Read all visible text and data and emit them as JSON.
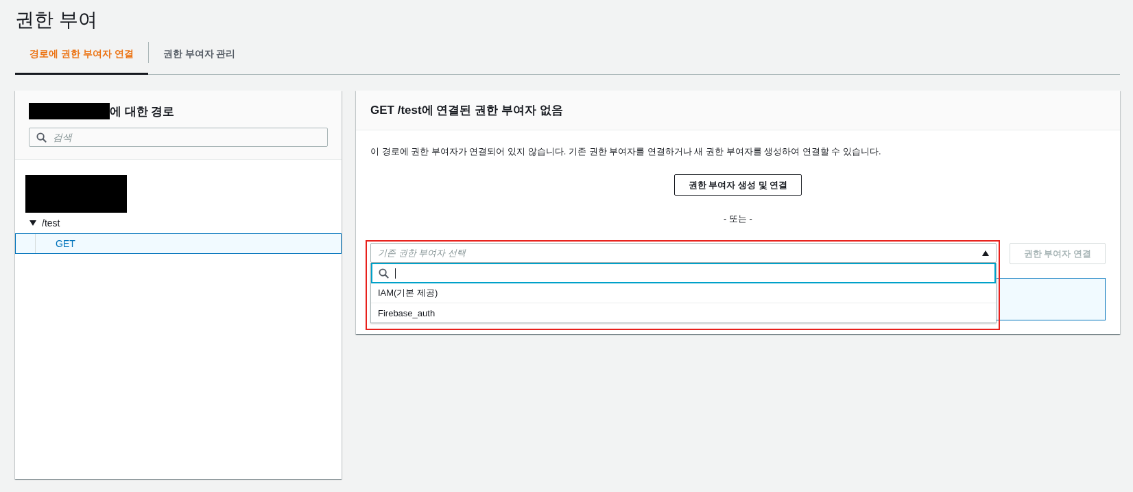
{
  "page": {
    "title": "권한 부여"
  },
  "tabs": [
    {
      "label": "경로에 권한 부여자 연결",
      "selected": true
    },
    {
      "label": "권한 부여자 관리",
      "selected": false
    }
  ],
  "routes_panel": {
    "title_suffix": "에 대한 경로",
    "search": {
      "placeholder": "검색"
    },
    "tree": [
      {
        "label": "/test",
        "expanded": true,
        "children": [
          {
            "label": "GET",
            "selected": true
          }
        ]
      }
    ]
  },
  "detail_panel": {
    "title": "GET /test에 연결된 권한 부여자 없음",
    "description": "이 경로에 권한 부여자가 연결되어 있지 않습니다. 기존 권한 부여자를 연결하거나 새 권한 부여자를 생성하여 연결할 수 있습니다.",
    "create_button": "권한 부여자 생성 및 연결",
    "separator": "- 또는 -",
    "select": {
      "placeholder": "기존 권한 부여자 선택",
      "expanded": true,
      "highlighted": true,
      "options": [
        {
          "label": "IAM(기본 제공)",
          "selected": false
        },
        {
          "label": "Firebase_auth",
          "selected": false
        }
      ]
    },
    "attach_button": {
      "label": "권한 부여자 연결",
      "disabled": true
    }
  }
}
